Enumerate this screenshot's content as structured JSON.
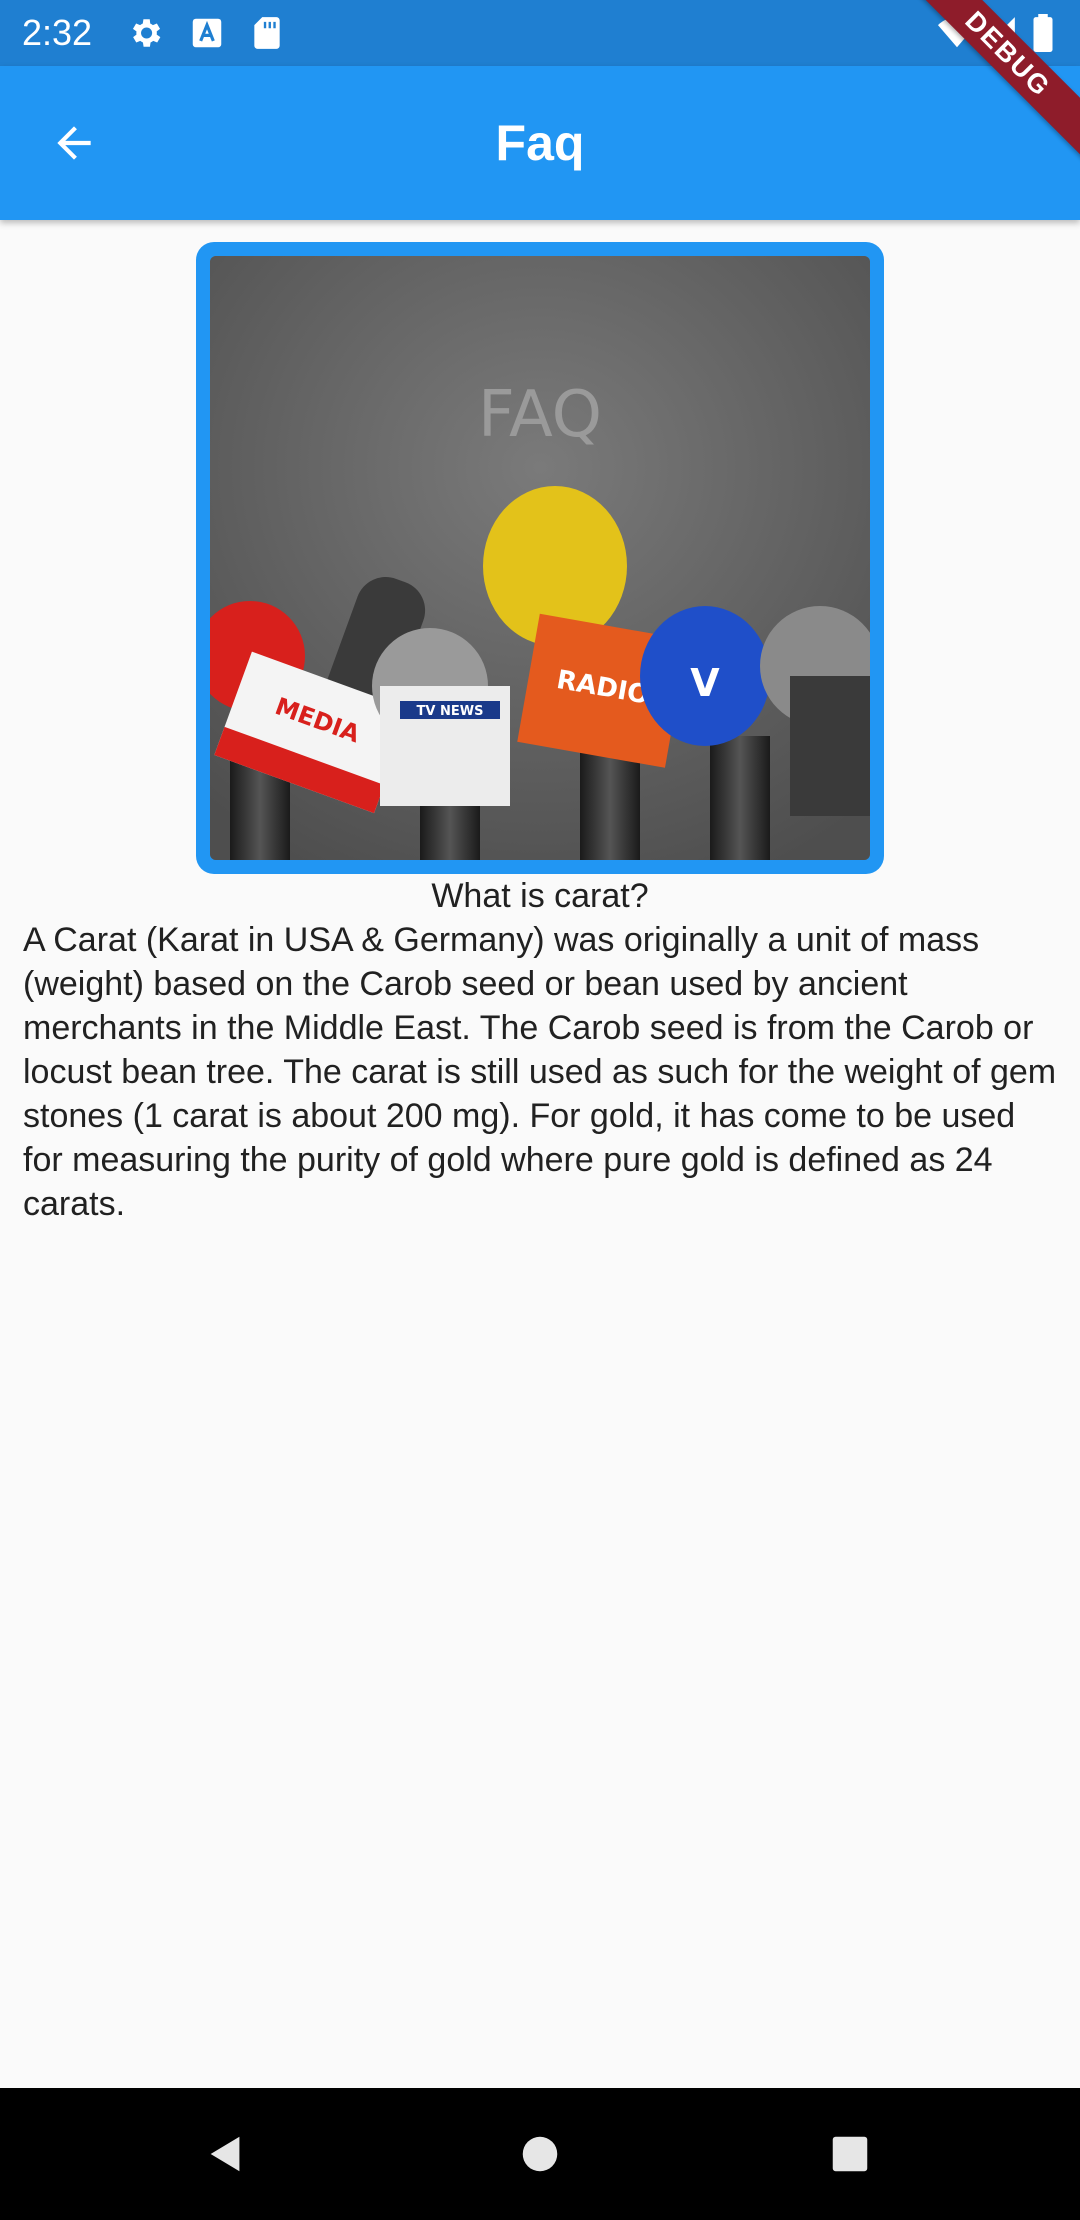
{
  "status_bar": {
    "time": "2:32",
    "icons_left": [
      "settings-icon",
      "text-a-icon",
      "sd-card-icon"
    ],
    "icons_right": [
      "wifi-icon",
      "cell-signal-icon",
      "battery-icon"
    ]
  },
  "app_bar": {
    "title": "Faq",
    "back_icon": "arrow-back-icon",
    "color": "#2196f3"
  },
  "debug_banner": {
    "label": "DEBUG",
    "color": "#8e1c2a"
  },
  "faq": {
    "image": {
      "label": "FAQ",
      "mic_flags": [
        "MEDIA",
        "TV NEWS",
        "RADIO",
        "V"
      ],
      "frame_color": "#2196f3"
    },
    "question": "What is carat?",
    "answer": "A Carat (Karat in USA & Germany) was originally a unit of mass (weight) based on the Carob seed or bean used by ancient merchants in the Middle East. The Carob seed is from the Carob or locust bean tree. The carat is still used as such for the weight of gem stones (1 carat is about 200 mg). For gold, it has come to be used for measuring the purity of gold where pure gold is defined as 24 carats."
  },
  "nav_bar": {
    "back_icon": "nav-back-icon",
    "home_icon": "nav-home-icon",
    "recents_icon": "nav-recents-icon"
  }
}
